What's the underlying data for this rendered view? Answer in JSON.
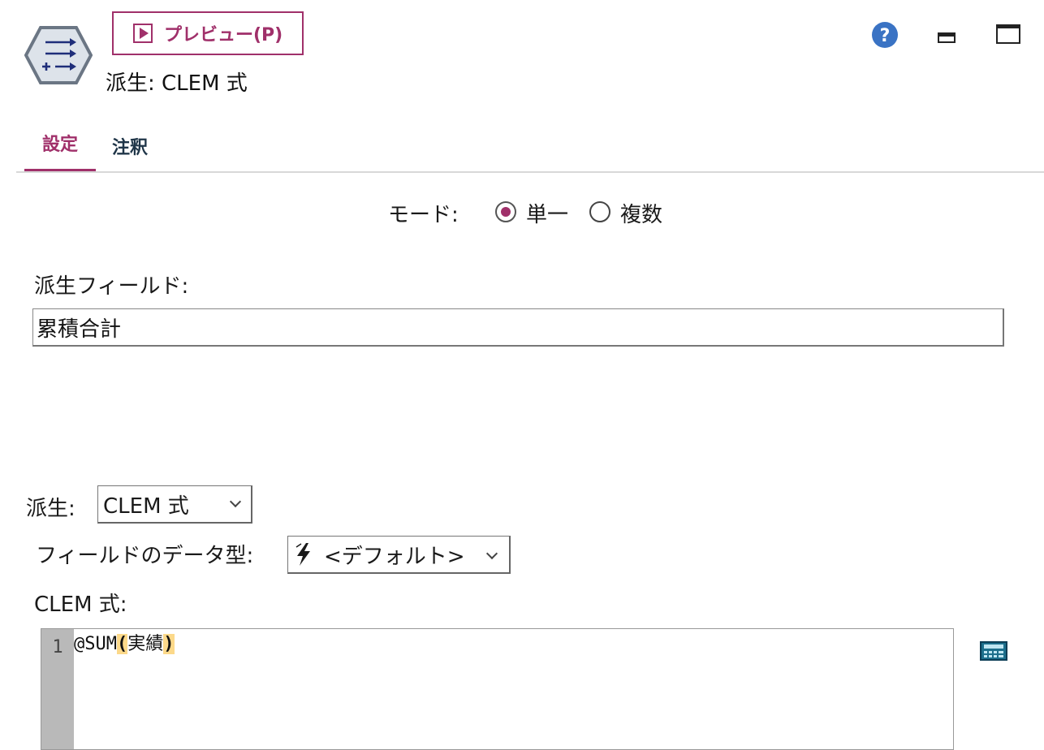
{
  "header": {
    "node_title": "派生: CLEM 式",
    "preview_label": "プレビュー(P)"
  },
  "icons": {
    "node": "derive-node-icon",
    "help": "help-icon",
    "minimize": "minimize-icon",
    "maximize": "maximize-icon",
    "play": "play-icon",
    "bolt": "lightning-icon",
    "calculator": "expression-builder-icon"
  },
  "tabs": [
    {
      "label": "設定",
      "active": true
    },
    {
      "label": "注釈",
      "active": false
    }
  ],
  "mode": {
    "label": "モード:",
    "options": [
      {
        "label": "単一",
        "selected": true
      },
      {
        "label": "複数",
        "selected": false
      }
    ]
  },
  "derive_field": {
    "label": "派生フィールド:",
    "value": "累積合計"
  },
  "derive_as": {
    "label": "派生:",
    "value": "CLEM 式"
  },
  "field_type": {
    "label": "フィールドのデータ型:",
    "value": "<デフォルト>"
  },
  "clem": {
    "label": "CLEM 式:",
    "line_number": "1",
    "code_prefix": "@SUM",
    "open_paren": "(",
    "arg": "実績",
    "close_paren": ")"
  },
  "colors": {
    "accent": "#a0306a",
    "tab_text": "#1f3548",
    "help_blue": "#3a73c4",
    "gutter": "#b9b9b9",
    "paren_highlight": "#fcd98a"
  }
}
